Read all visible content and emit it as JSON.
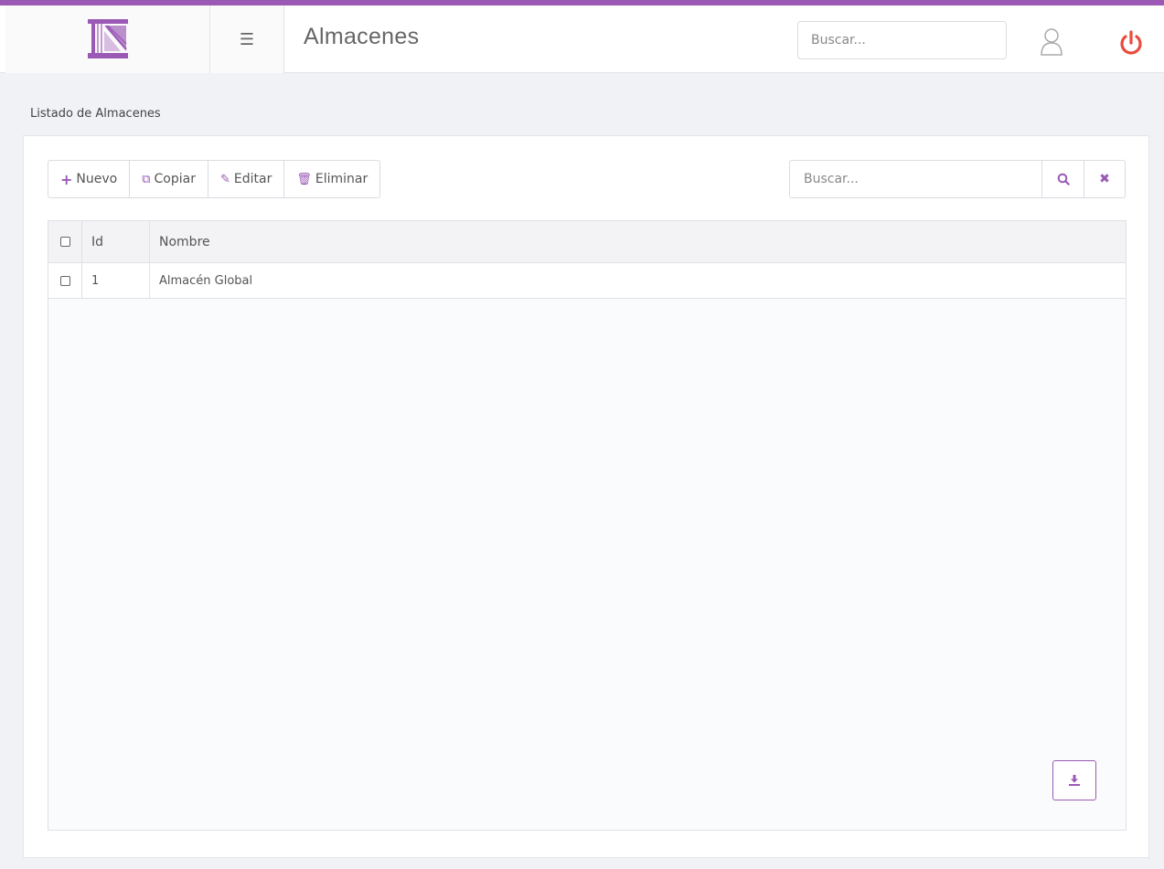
{
  "header": {
    "title": "Almacenes",
    "search_placeholder": "Buscar...",
    "menu_icon": "☰",
    "accent_color": "#9b59b6",
    "power_color": "#e74c3c"
  },
  "page": {
    "subtitle": "Listado de Almacenes"
  },
  "toolbar": {
    "nuevo": "Nuevo",
    "copiar": "Copiar",
    "editar": "Editar",
    "eliminar": "Eliminar"
  },
  "list_search": {
    "placeholder": "Buscar..."
  },
  "table": {
    "columns": {
      "id": "Id",
      "nombre": "Nombre"
    },
    "rows": [
      {
        "id": "1",
        "nombre": "Almacén Global"
      }
    ]
  },
  "icons": {
    "logo": "castle-logo-icon",
    "menu": "hamburger-icon",
    "user": "user-icon",
    "power": "power-icon",
    "nuevo": "plus-icon",
    "copiar": "copy-icon",
    "editar": "edit-icon",
    "eliminar": "trash-icon",
    "search": "search-icon",
    "clear": "close-icon",
    "export": "download-icon"
  }
}
